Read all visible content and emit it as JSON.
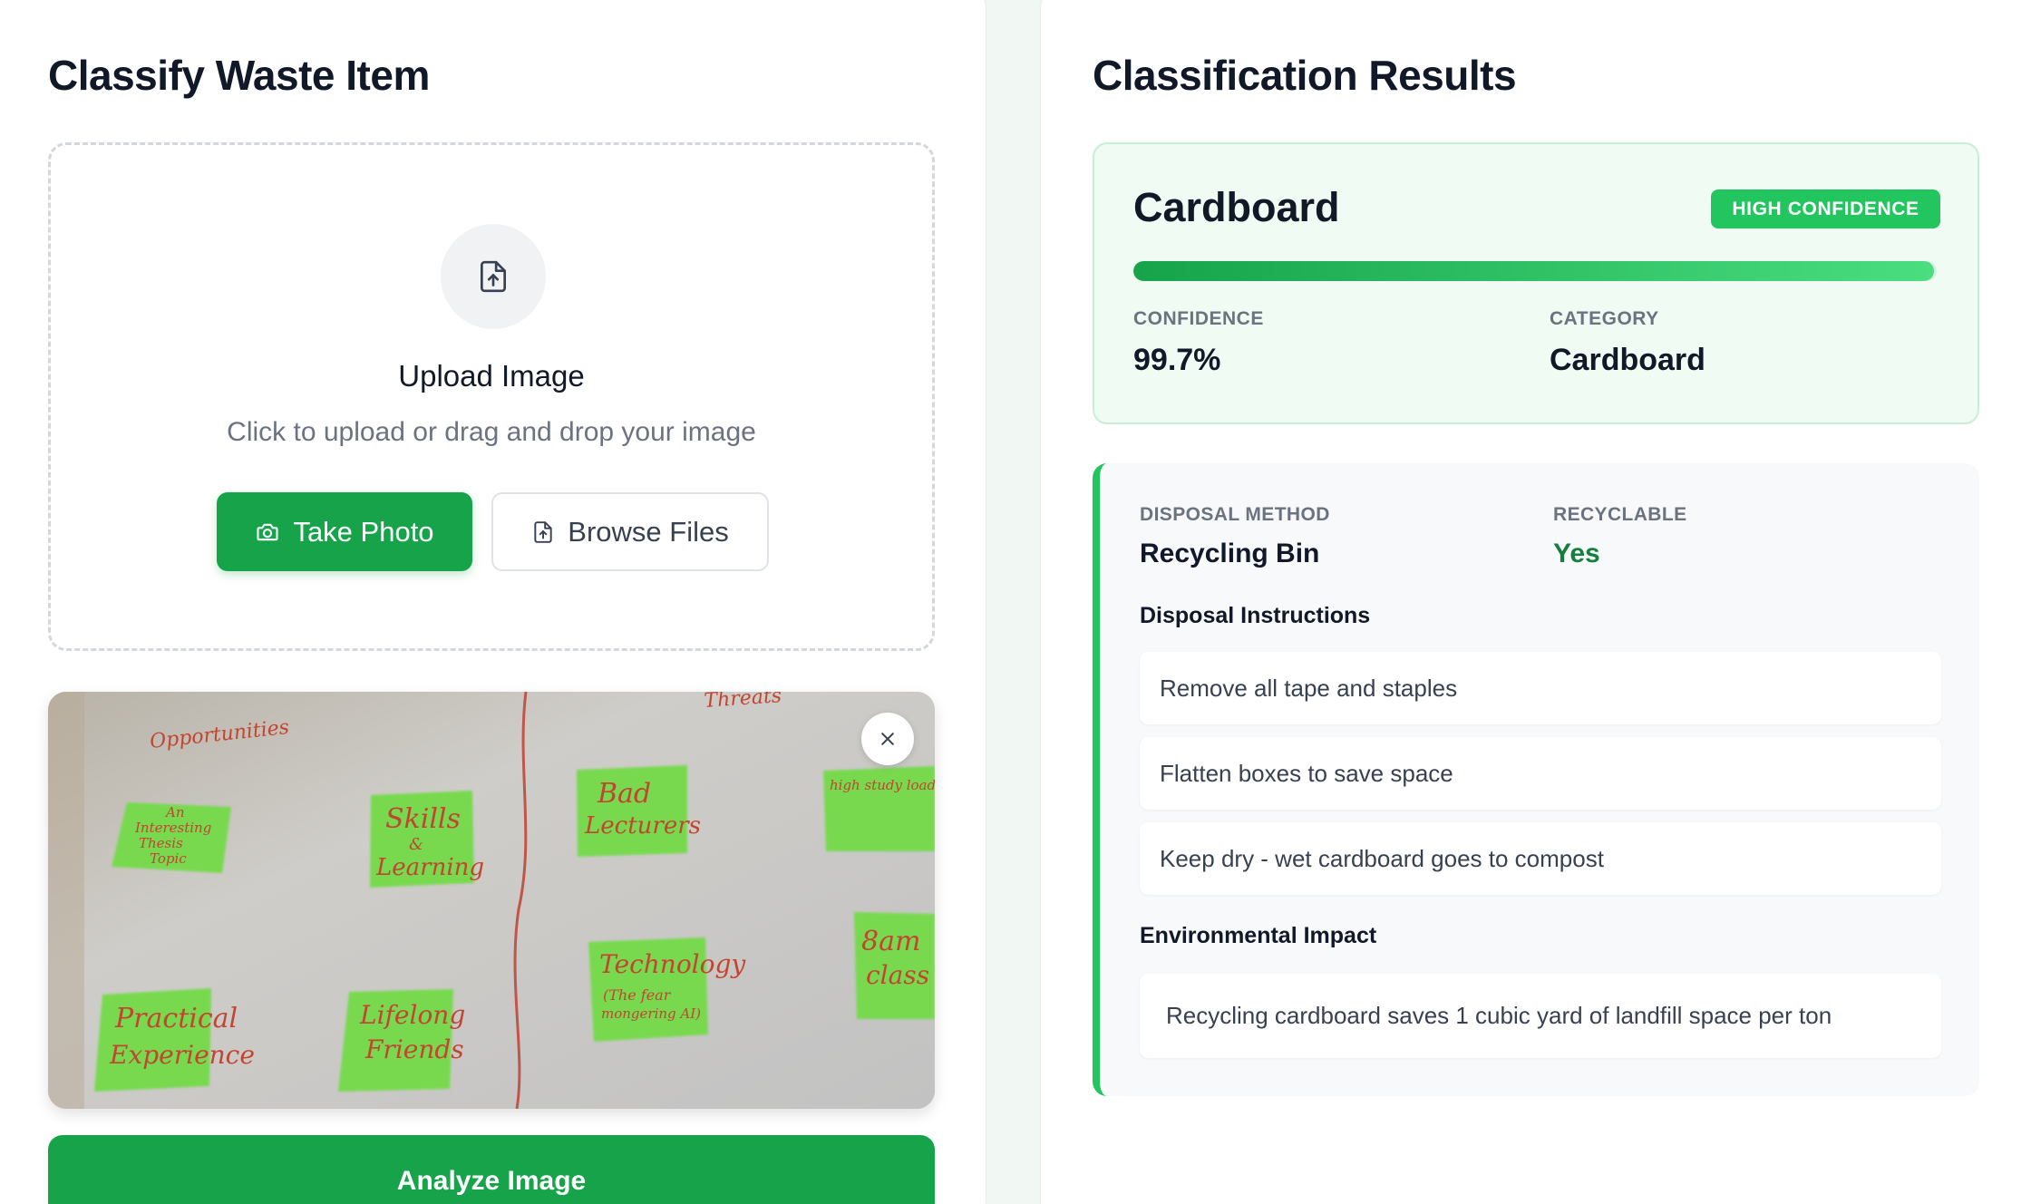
{
  "left": {
    "title": "Classify Waste Item",
    "upload": {
      "heading": "Upload Image",
      "subtext": "Click to upload or drag and drop your image",
      "take_photo_label": "Take Photo",
      "browse_label": "Browse Files"
    },
    "analyze_label": "Analyze Image"
  },
  "right": {
    "title": "Classification Results",
    "result": {
      "name": "Cardboard",
      "badge": "HIGH CONFIDENCE",
      "confidence_fraction": 0.997,
      "confidence_label": "CONFIDENCE",
      "confidence_value": "99.7%",
      "category_label": "CATEGORY",
      "category_value": "Cardboard"
    },
    "details": {
      "disposal_label": "DISPOSAL METHOD",
      "disposal_value": "Recycling Bin",
      "recyclable_label": "RECYCLABLE",
      "recyclable_value": "Yes",
      "instructions_heading": "Disposal Instructions",
      "instructions": [
        "Remove all tape and staples",
        "Flatten boxes to save space",
        "Keep dry - wet cardboard goes to compost"
      ],
      "impact_heading": "Environmental Impact",
      "impact_text": "Recycling cardboard saves 1 cubic yard of landfill space per ton"
    }
  },
  "colors": {
    "accent": "#16a34a",
    "badge": "#22c55e",
    "result_bg": "#effbf3",
    "recyclable_text": "#15803d"
  },
  "icons": {
    "upload": "file-upload-icon",
    "camera": "camera-icon",
    "browse": "file-upload-icon",
    "close": "close-icon"
  }
}
